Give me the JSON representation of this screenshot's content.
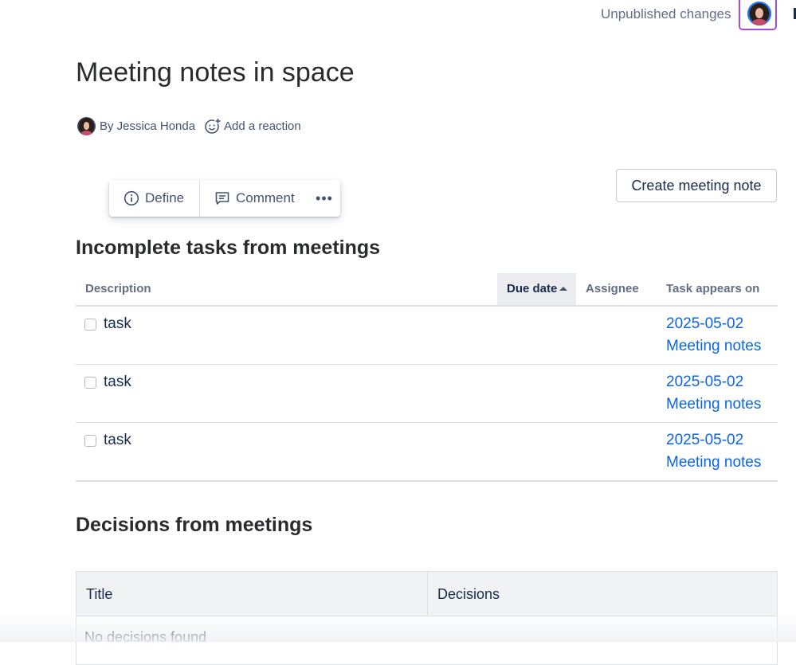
{
  "header": {
    "status_text": "Unpublished changes"
  },
  "page": {
    "title": "Meeting notes in space",
    "byline": "By Jessica Honda",
    "reaction_label": "Add a reaction"
  },
  "toolbar": {
    "define_label": "Define",
    "comment_label": "Comment",
    "more_label": "•••"
  },
  "create_button_label": "Create meeting note",
  "tasks": {
    "heading": "Incomplete tasks from meetings",
    "columns": [
      "Description",
      "Due date",
      "Assignee",
      "Task appears on"
    ],
    "rows": [
      {
        "description": "task",
        "due": "",
        "assignee": "",
        "appears_date": "2025-05-02",
        "appears_title": "Meeting notes"
      },
      {
        "description": "task",
        "due": "",
        "assignee": "",
        "appears_date": "2025-05-02",
        "appears_title": "Meeting notes"
      },
      {
        "description": "task",
        "due": "",
        "assignee": "",
        "appears_date": "2025-05-02",
        "appears_title": "Meeting notes"
      }
    ]
  },
  "decisions": {
    "heading": "Decisions from meetings",
    "columns": [
      "Title",
      "Decisions"
    ],
    "empty_text": "No decisions found"
  },
  "colors": {
    "link": "#0c66e4",
    "avatar_highlight": "#a54ce0"
  }
}
